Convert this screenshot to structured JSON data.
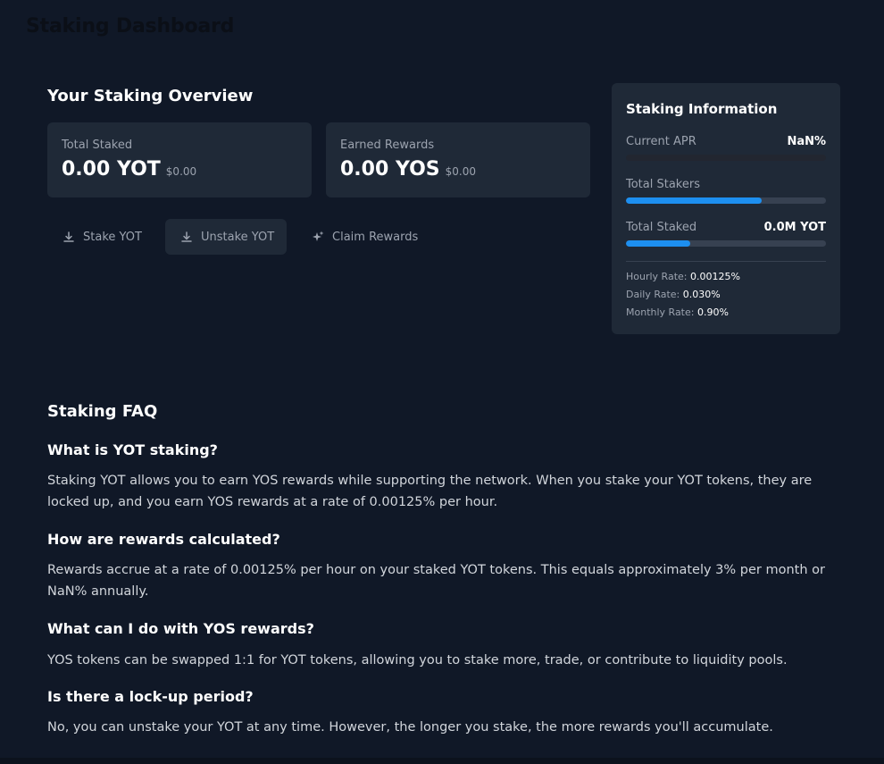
{
  "page": {
    "title": "Staking Dashboard"
  },
  "overview": {
    "title": "Your Staking Overview",
    "total_staked": {
      "label": "Total Staked",
      "value": "0.00 YOT",
      "usd": "$0.00"
    },
    "earned_rewards": {
      "label": "Earned Rewards",
      "value": "0.00 YOS",
      "usd": "$0.00"
    }
  },
  "actions": {
    "stake": {
      "label": "Stake YOT",
      "icon": "download-icon"
    },
    "unstake": {
      "label": "Unstake YOT",
      "icon": "download-icon",
      "active": true
    },
    "claim": {
      "label": "Claim Rewards",
      "icon": "sparkles-icon"
    }
  },
  "info": {
    "title": "Staking Information",
    "apr": {
      "label": "Current APR",
      "value": "NaN%",
      "progress": 0
    },
    "stakers": {
      "label": "Total Stakers",
      "progress": 0.68
    },
    "staked": {
      "label": "Total Staked",
      "value": "0.0M YOT",
      "progress": 0.32
    },
    "rates": {
      "hourly_label": "Hourly Rate:",
      "hourly": "0.00125%",
      "daily_label": "Daily Rate:",
      "daily": "0.030%",
      "monthly_label": "Monthly Rate:",
      "monthly": "0.90%"
    },
    "accent_color": "#1d8ff0"
  },
  "faq": {
    "title": "Staking FAQ",
    "items": [
      {
        "q": "What is YOT staking?",
        "a": "Staking YOT allows you to earn YOS rewards while supporting the network. When you stake your YOT tokens, they are locked up, and you earn YOS rewards at a rate of 0.00125% per hour."
      },
      {
        "q": "How are rewards calculated?",
        "a": "Rewards accrue at a rate of 0.00125% per hour on your staked YOT tokens. This equals approximately 3% per month or NaN% annually."
      },
      {
        "q": "What can I do with YOS rewards?",
        "a": "YOS tokens can be swapped 1:1 for YOT tokens, allowing you to stake more, trade, or contribute to liquidity pools."
      },
      {
        "q": "Is there a lock-up period?",
        "a": "No, you can unstake your YOT at any time. However, the longer you stake, the more rewards you'll accumulate."
      }
    ]
  }
}
